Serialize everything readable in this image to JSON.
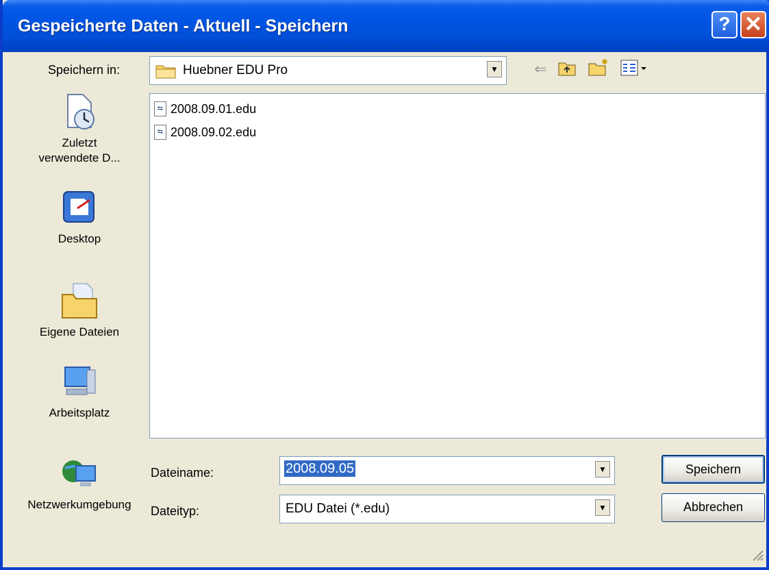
{
  "window": {
    "title": "Gespeicherte Daten - Aktuell - Speichern",
    "help_label": "?",
    "close_label": "✕"
  },
  "toolbar": {
    "save_in_label": "Speichern in:",
    "current_folder": "Huebner EDU Pro",
    "icons": [
      "back-arrow-icon",
      "up-folder-icon",
      "new-folder-icon",
      "view-menu-icon"
    ]
  },
  "places": [
    {
      "label": "Zuletzt verwendete D...",
      "icon": "recent-documents-icon"
    },
    {
      "label": "Desktop",
      "icon": "desktop-icon"
    },
    {
      "label": "Eigene Dateien",
      "icon": "my-documents-icon"
    },
    {
      "label": "Arbeitsplatz",
      "icon": "my-computer-icon"
    },
    {
      "label": "Netzwerkumgebung",
      "icon": "network-places-icon"
    }
  ],
  "files": [
    {
      "name": "2008.09.01.edu"
    },
    {
      "name": "2008.09.02.edu"
    }
  ],
  "form": {
    "filename_label": "Dateiname:",
    "filename_value": "2008.09.05",
    "filetype_label": "Dateityp:",
    "filetype_value": "EDU Datei (*.edu)"
  },
  "buttons": {
    "save": "Speichern",
    "cancel": "Abbrechen"
  }
}
